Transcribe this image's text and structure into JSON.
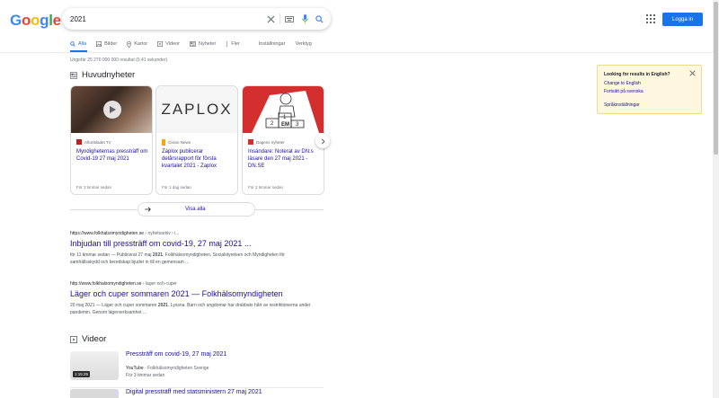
{
  "logo": {
    "letters": [
      "G",
      "o",
      "o",
      "g",
      "l",
      "e"
    ],
    "colors": [
      "#4285f4",
      "#ea4335",
      "#fbbc05",
      "#4285f4",
      "#34a853",
      "#ea4335"
    ]
  },
  "search": {
    "query": "2021"
  },
  "header": {
    "login_label": "Logga in"
  },
  "tabs": [
    {
      "label": "Alla",
      "icon": "search-icon"
    },
    {
      "label": "Bilder",
      "icon": "image-icon"
    },
    {
      "label": "Kartor",
      "icon": "map-pin-icon"
    },
    {
      "label": "Videor",
      "icon": "video-icon"
    },
    {
      "label": "Nyheter",
      "icon": "news-icon"
    },
    {
      "label": "Fler",
      "icon": "more-icon"
    },
    {
      "label": "Inställningar",
      "icon": ""
    },
    {
      "label": "Verktyg",
      "icon": ""
    }
  ],
  "results_count": "Ungefär 25 270 000 000 resultat (0,41 sekunder)",
  "news": {
    "title": "Huvudnyheter",
    "cards": [
      {
        "source": "Aftonbladet TV",
        "title": "Myndigheternas pressträff om Covid-19 27 maj 2021",
        "age": "För 3 timmar sedan"
      },
      {
        "source": "Cision News",
        "title": "Zaplox publicerar delårsrapport för första kvartalet 2021 - Zaplox",
        "age": "För 1 dag sedan",
        "logo_text": "ZAPLOX"
      },
      {
        "source": "Dagens nyheter",
        "title": "Insändare: Noterat av DN:s läsare den 27 maj 2021 - DN.SE",
        "age": "För 2 timmar sedan",
        "podium": [
          "2",
          "1",
          "EM",
          "3"
        ]
      }
    ],
    "view_all": "Visa alla"
  },
  "results": [
    {
      "url": "https://www.folkhalsomyndigheten.se",
      "crumb": "› nyhetsarkiv › i...",
      "title": "Inbjudan till pressträff om covid-19, 27 maj 2021 ...",
      "snippet_pre": "för 11 timmar sedan — Publicerat 27 maj ",
      "snippet_bold": "2021",
      "snippet_post": ". Folkhälsomyndigheten, Socialstyrelsen och Myndigheten för samhällsskydd och beredskap bjuder in till en gemensam ..."
    },
    {
      "url": "http://www.folkhalsomyndigheten.se",
      "crumb": "› lager-och-cuper",
      "title": "Läger och cuper sommaren 2021 — Folkhälsomyndigheten",
      "snippet_pre": "20 maj 2021 — Läger och cuper sommaren ",
      "snippet_bold": "2021",
      "snippet_post": ". Lyssna. Barn och ungdomar har drabbats hårt av restriktionerna under pandemin. Genom lägerverksamhet ..."
    }
  ],
  "videos": {
    "title": "Videor",
    "items": [
      {
        "title": "Pressträff om covid-19, 27 maj 2021",
        "platform": "YouTube",
        "channel": "· Folkhälsomyndigheten Sverige",
        "age": "För 3 timmar sedan",
        "duration": "1:15:25"
      },
      {
        "title": "Digital pressträff med statsministern 27 maj 2021"
      }
    ]
  },
  "lang_box": {
    "heading": "Looking for results in English?",
    "change": "Change to English",
    "continue": "Fortsätt på svenska",
    "settings": "Språkinställningar"
  }
}
